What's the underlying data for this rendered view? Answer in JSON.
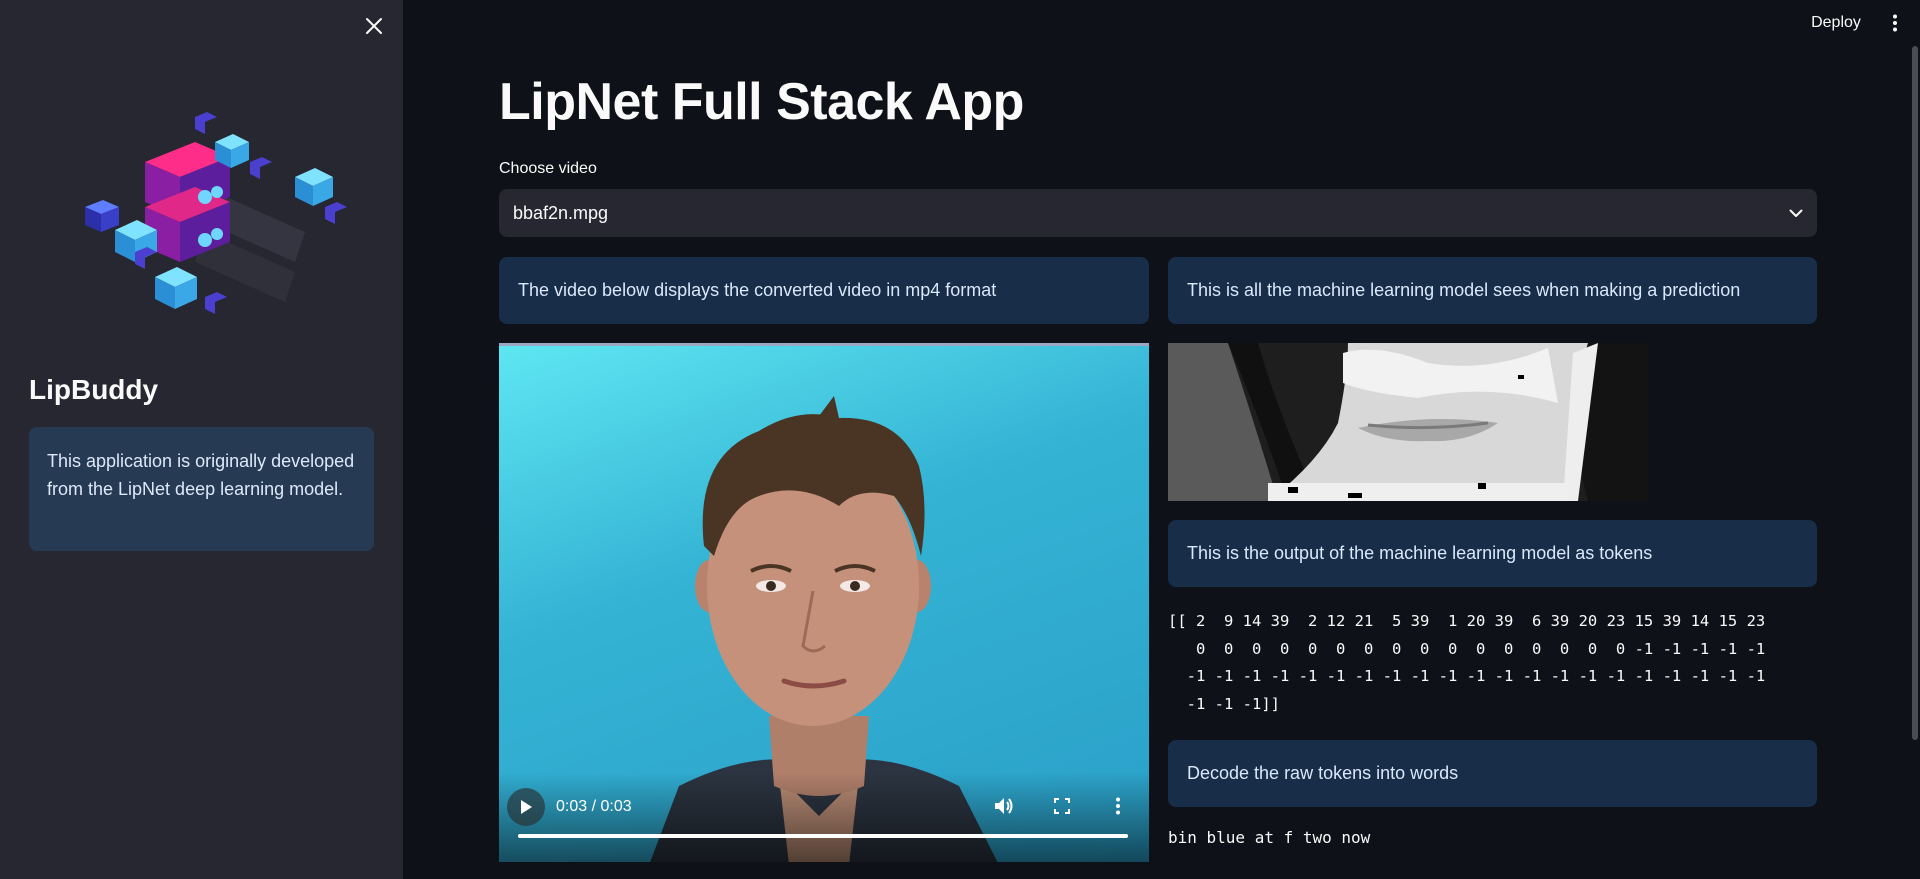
{
  "sidebar": {
    "title": "LipBuddy",
    "info": "This application is originally developed from the LipNet deep learning model.",
    "close_icon": "close-icon",
    "logo_icon": "server-cubes-logo"
  },
  "header": {
    "deploy_label": "Deploy",
    "menu_icon": "more-vertical-icon"
  },
  "main": {
    "title": "LipNet Full Stack App",
    "select_label": "Choose video",
    "selected_video": "bbaf2n.mpg",
    "left_callout": "The video below displays the converted video in mp4 format",
    "right_callout": "This is all the machine learning model sees when making a prediction",
    "tokens_callout": "This is the output of the machine learning model as tokens",
    "tokens_text": "[[ 2  9 14 39  2 12 21  5 39  1 20 39  6 39 20 23 15 39 14 15 23\n   0  0  0  0  0  0  0  0  0  0  0  0  0  0  0  0 -1 -1 -1 -1 -1\n  -1 -1 -1 -1 -1 -1 -1 -1 -1 -1 -1 -1 -1 -1 -1 -1 -1 -1 -1 -1 -1\n  -1 -1 -1]]",
    "decode_callout": "Decode the raw tokens into words",
    "decoded_text": "bin blue at f two now"
  },
  "video": {
    "time": "0:03 / 0:03",
    "progress": 1.0
  },
  "colors": {
    "sidebar_bg": "#262730",
    "main_bg": "#0e1117",
    "callout_bg": "#172d48",
    "info_bg": "#273a53"
  }
}
